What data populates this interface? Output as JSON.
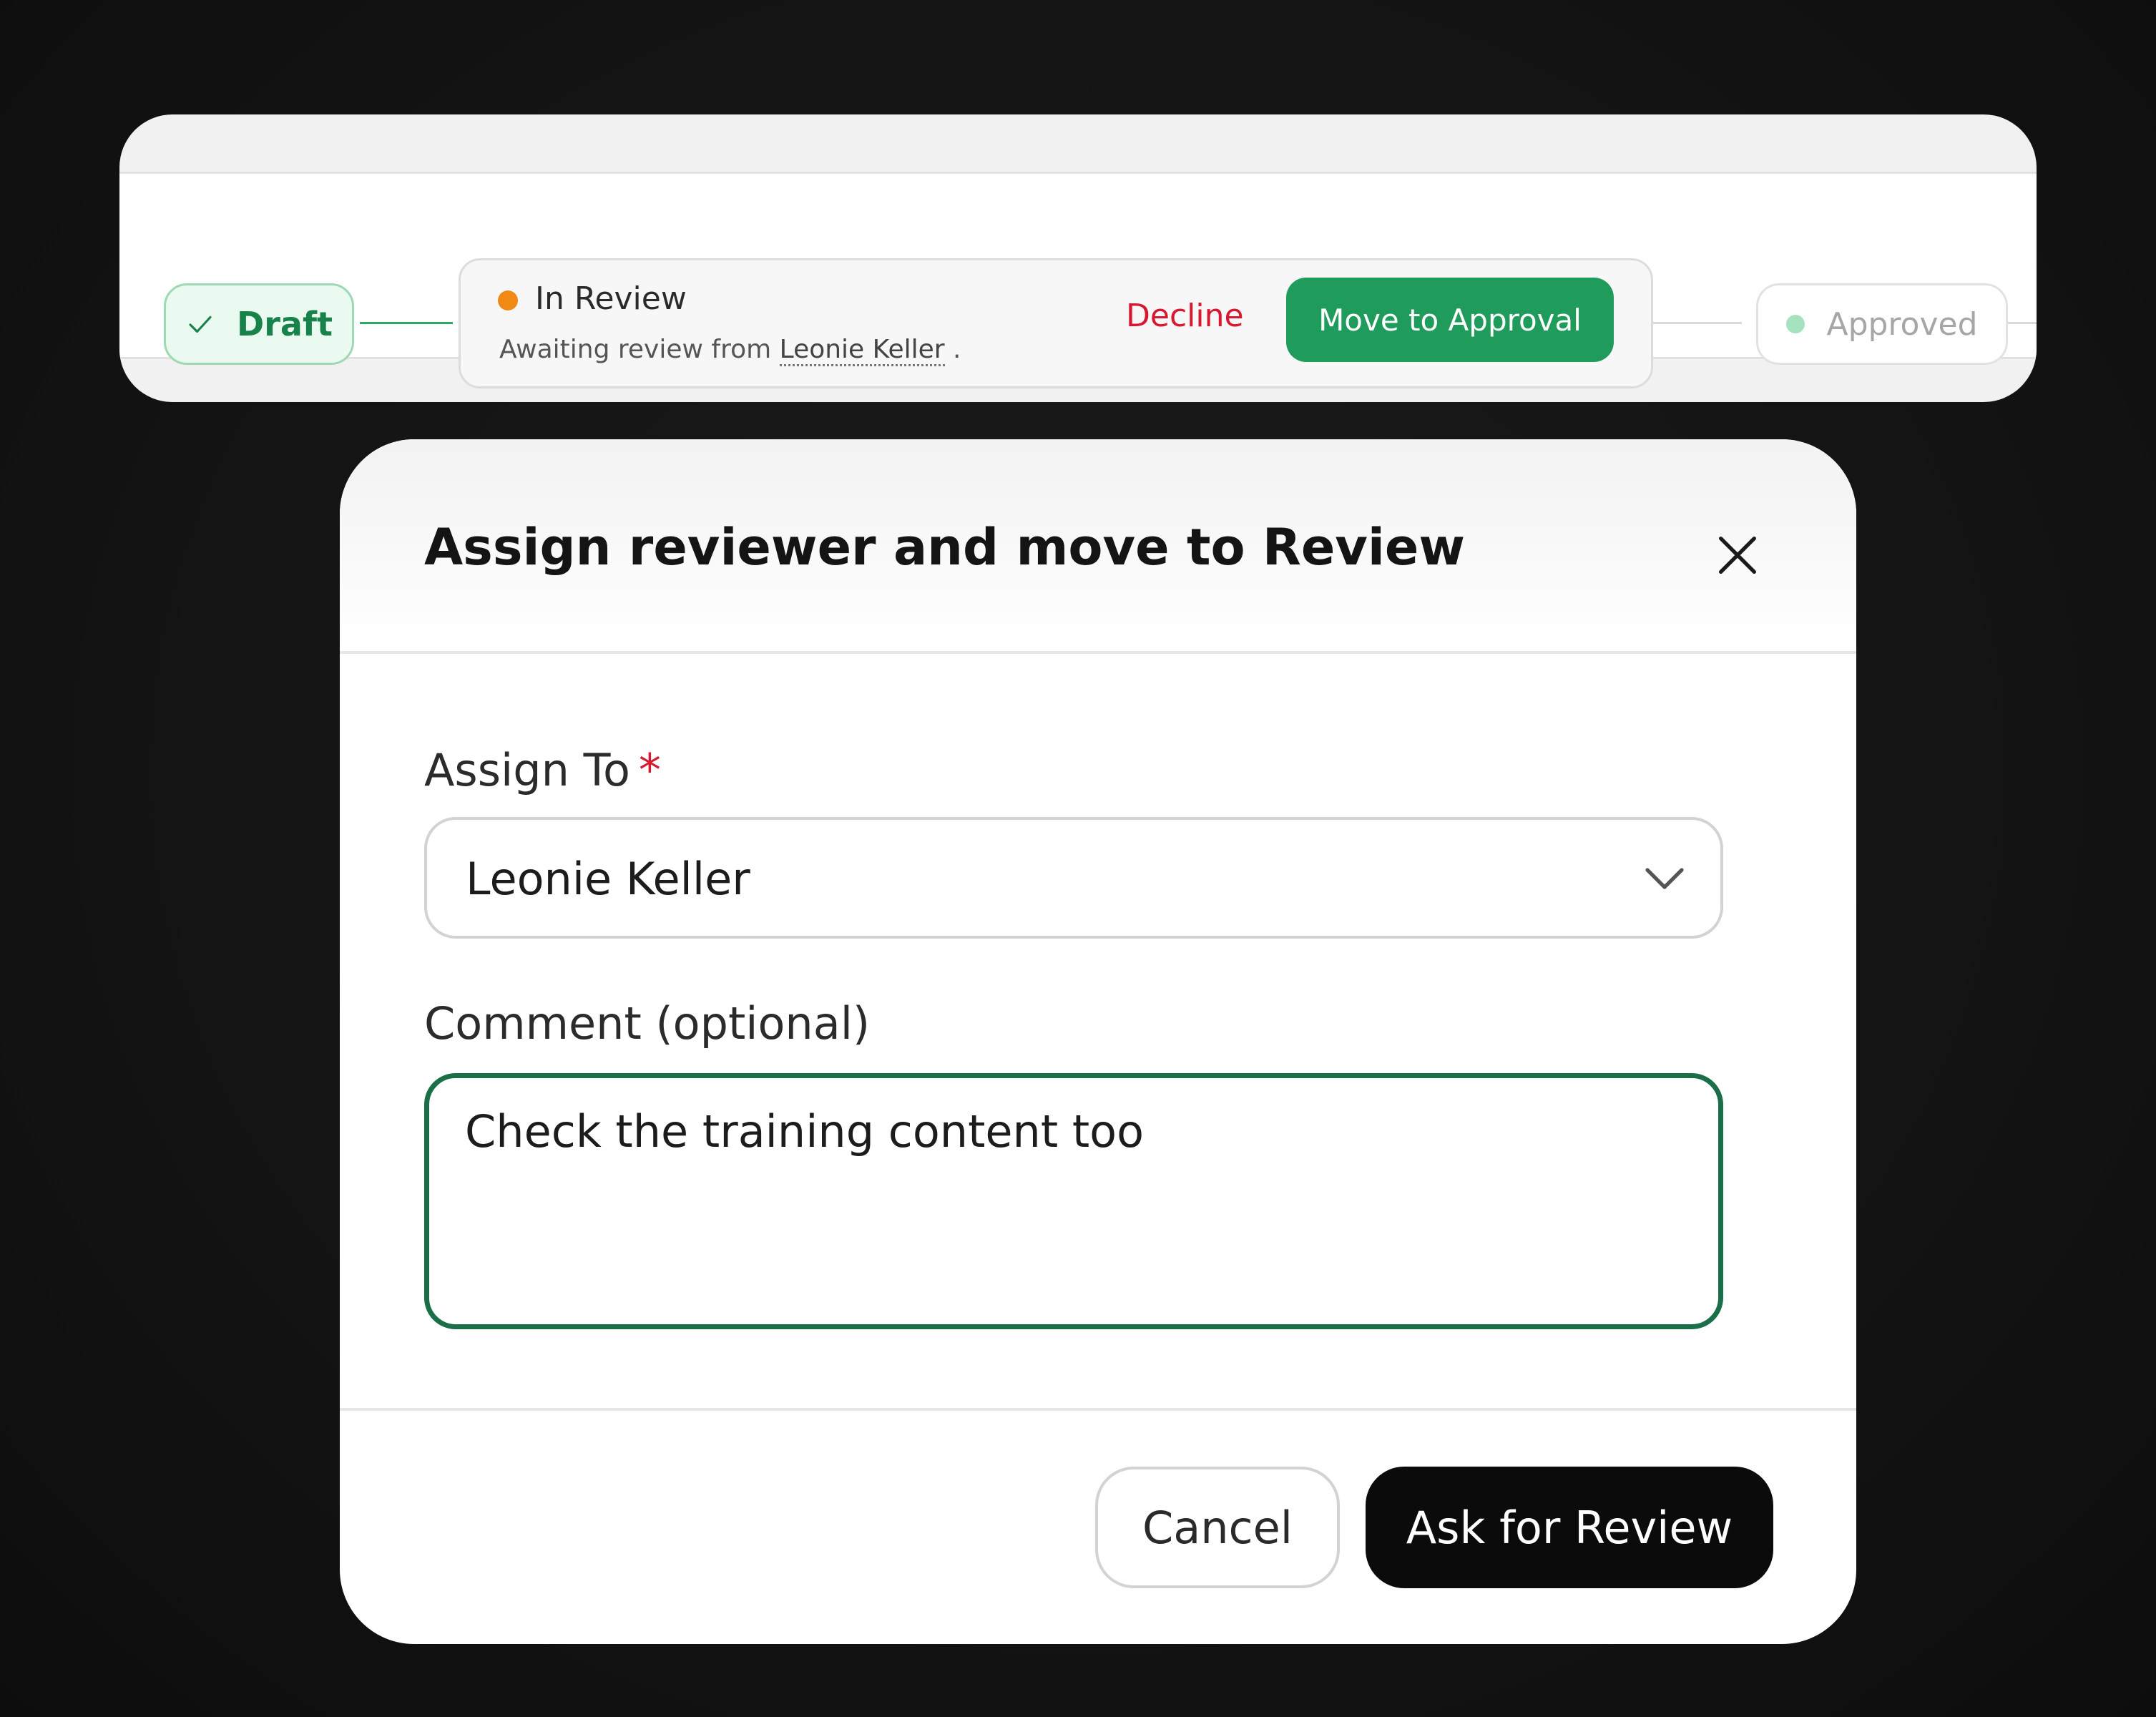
{
  "workflow": {
    "stages": {
      "draft": {
        "label": "Draft",
        "icon": "check-icon",
        "color": "#17824a"
      },
      "in_review": {
        "label": "In Review",
        "status_color": "#f08a14",
        "subtitle_prefix": "Awaiting review from",
        "reviewer": "Leonie Keller",
        "subtitle_suffix": ".",
        "decline_label": "Decline",
        "approve_label": "Move to Approval"
      },
      "approved": {
        "label": "Approved",
        "dot_color": "#a5e3bf"
      }
    }
  },
  "modal": {
    "title": "Assign reviewer and move to Review",
    "close_icon": "close-icon",
    "assign_label": "Assign To",
    "required_mark": "*",
    "assignee": "Leonie Keller",
    "dropdown_icon": "chevron-down-icon",
    "comment_label": "Comment (optional)",
    "comment_value": "Check the training content too",
    "cancel_label": "Cancel",
    "submit_label": "Ask for Review"
  },
  "colors": {
    "accent_green": "#1f9b5b",
    "focus_border": "#1a6e48",
    "danger": "#d8182e",
    "primary_dark": "#0b0b0b"
  }
}
